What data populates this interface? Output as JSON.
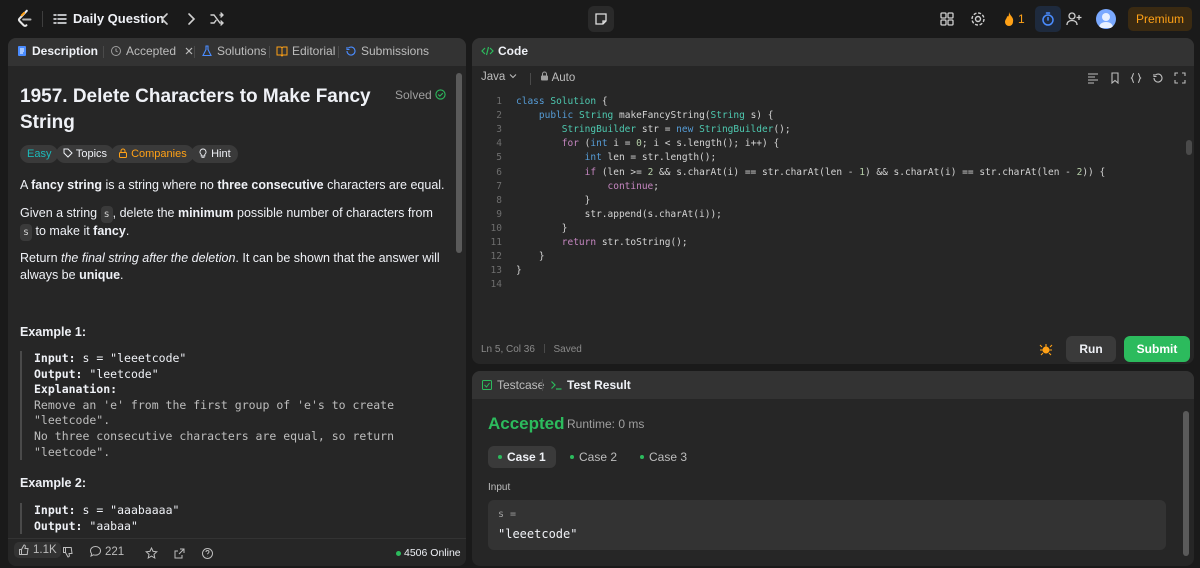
{
  "topbar": {
    "title": "Daily Question",
    "streak": "1",
    "premium_label": "Premium"
  },
  "left_panel": {
    "tabs": [
      "Description",
      "Accepted",
      "Solutions",
      "Editorial",
      "Submissions"
    ],
    "question_title": "1957. Delete Characters to Make Fancy String",
    "solved_label": "Solved",
    "tags": [
      "Easy",
      "Topics",
      "Companies",
      "Hint"
    ],
    "p1": {
      "a": "A ",
      "b": "fancy string",
      "c": " is a string where no ",
      "d": "three consecutive",
      "e": " characters are equal."
    },
    "p2": {
      "a": "Given a string ",
      "code1": "s",
      "b": ", delete the ",
      "c": "minimum",
      "d": " possible number of characters from ",
      "code2": "s",
      "e": " to make it ",
      "f": "fancy",
      "g": "."
    },
    "p3": {
      "a": "Return ",
      "b": "the final string after the deletion",
      "c": ". It can be shown that the answer will always be ",
      "d": "unique",
      "e": "."
    },
    "example1": {
      "title": "Example 1:",
      "input_label": "Input:",
      "input": "s = \"leeetcode\"",
      "output_label": "Output:",
      "output": "\"leetcode\"",
      "explanation_label": "Explanation:",
      "explanation": [
        "Remove an 'e' from the first group of 'e's to create",
        "\"leetcode\".",
        "No three consecutive characters are equal, so return",
        "\"leetcode\"."
      ]
    },
    "example2": {
      "title": "Example 2:",
      "input_label": "Input:",
      "input": "s = \"aaabaaaa\"",
      "output_label": "Output:",
      "output": "\"aabaa\""
    },
    "footer": {
      "likes": "1.1K",
      "comments": "221",
      "online": "4506 Online"
    }
  },
  "code_panel": {
    "title": "Code",
    "language": "Java",
    "mode": "Auto",
    "lines": [
      "class Solution {",
      "    public String makeFancyString(String s) {",
      "        StringBuilder str = new StringBuilder();",
      "        for (int i = 0; i < s.length(); i++) {",
      "            int len = str.length();",
      "            if (len >= 2 && s.charAt(i) == str.charAt(len - 1) && s.charAt(i) == str.charAt(len - 2)) {",
      "                continue;",
      "            }",
      "            str.append(s.charAt(i));",
      "        }",
      "        return str.toString();",
      "    }",
      "}",
      ""
    ],
    "status": "Ln 5, Col 36",
    "saved": "Saved",
    "run_label": "Run",
    "submit_label": "Submit"
  },
  "result_panel": {
    "tabs": [
      "Testcase",
      "Test Result"
    ],
    "verdict": "Accepted",
    "runtime": "Runtime: 0 ms",
    "cases": [
      "Case 1",
      "Case 2",
      "Case 3"
    ],
    "input_label": "Input",
    "input_name": "s =",
    "input_value": "\"leeetcode\""
  }
}
